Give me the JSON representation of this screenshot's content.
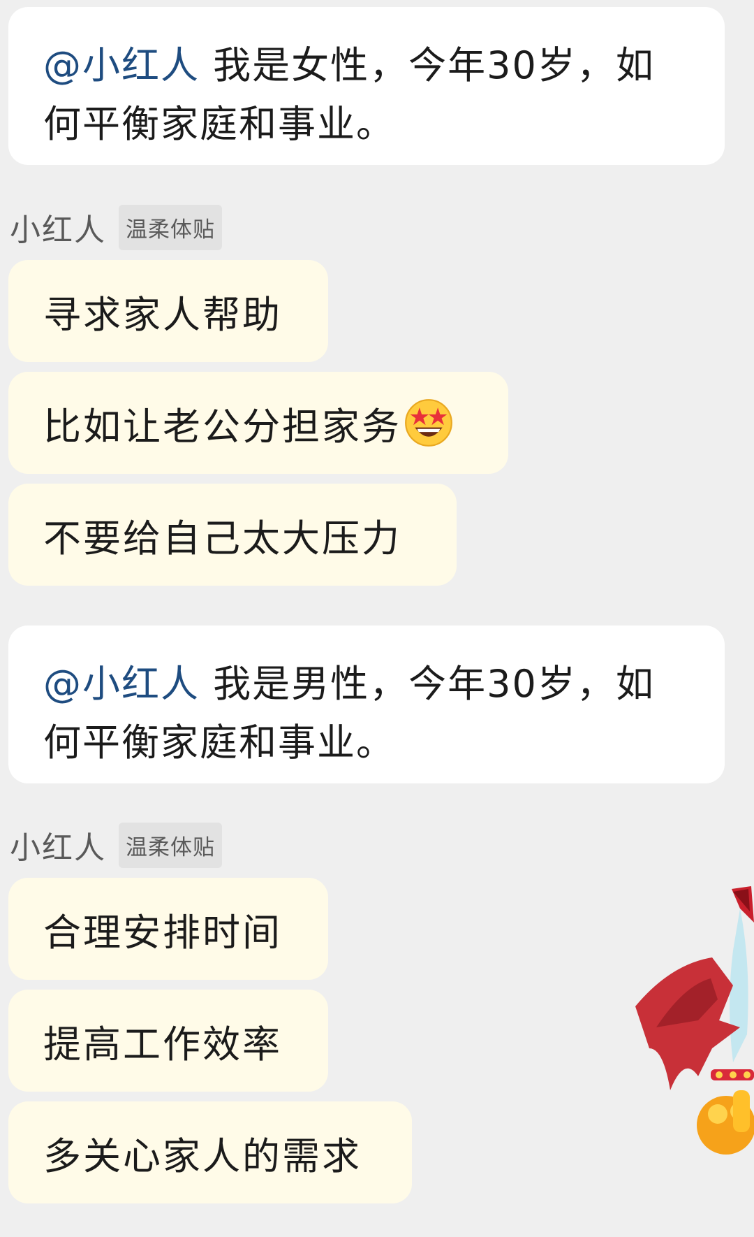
{
  "messages": [
    {
      "type": "question",
      "mention": "@小红人",
      "text_line1": " 我是女性，今年30岁，如",
      "text_line2": "何平衡家庭和事业。"
    },
    {
      "type": "sender",
      "name": "小红人",
      "tag": "温柔体贴"
    },
    {
      "type": "replies",
      "items": [
        "寻求家人帮助",
        "比如让老公分担家务",
        "不要给自己太大压力"
      ]
    },
    {
      "type": "question",
      "mention": "@小红人",
      "text_line1": " 我是男性，今年30岁，如",
      "text_line2": "何平衡家庭和事业。"
    },
    {
      "type": "sender",
      "name": "小红人",
      "tag": "温柔体贴"
    },
    {
      "type": "replies",
      "items": [
        "合理安排时间",
        "提高工作效率",
        "多关心家人的需求"
      ]
    }
  ],
  "icons": {
    "reply2_emoji": "star-struck-emoji",
    "sticker": "red-cat-sticker"
  },
  "colors": {
    "background": "#efefef",
    "question_bubble": "#ffffff",
    "reply_bubble": "#fffbe8",
    "mention": "#1e4c80",
    "tag_bg": "#e2e2e2"
  }
}
